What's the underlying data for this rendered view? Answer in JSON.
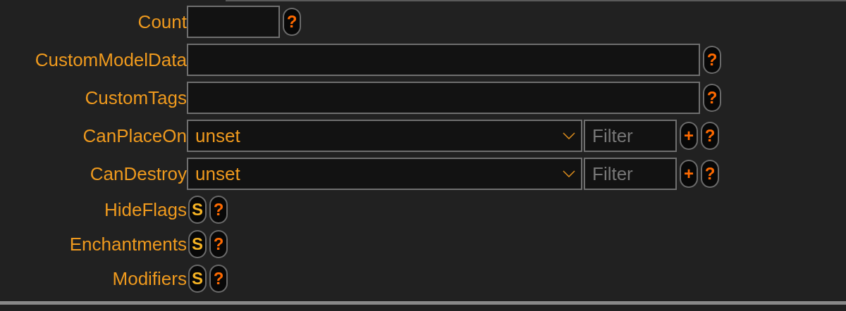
{
  "fields": [
    {
      "kind": "number",
      "label": "Count",
      "help": "?"
    },
    {
      "kind": "text",
      "label": "CustomModelData",
      "help": "?"
    },
    {
      "kind": "text",
      "label": "CustomTags",
      "help": "?"
    },
    {
      "kind": "list",
      "label": "CanPlaceOn",
      "value": "unset",
      "filter": {
        "placeholder": "Filter"
      },
      "add": "+",
      "help": "?"
    },
    {
      "kind": "list",
      "label": "CanDestroy",
      "value": "unset",
      "filter": {
        "placeholder": "Filter"
      },
      "add": "+",
      "help": "?"
    },
    {
      "kind": "compound",
      "label": "HideFlags",
      "open": "S",
      "help": "?"
    },
    {
      "kind": "compound",
      "label": "Enchantments",
      "open": "S",
      "help": "?"
    },
    {
      "kind": "compound",
      "label": "Modifiers",
      "open": "S",
      "help": "?"
    }
  ]
}
